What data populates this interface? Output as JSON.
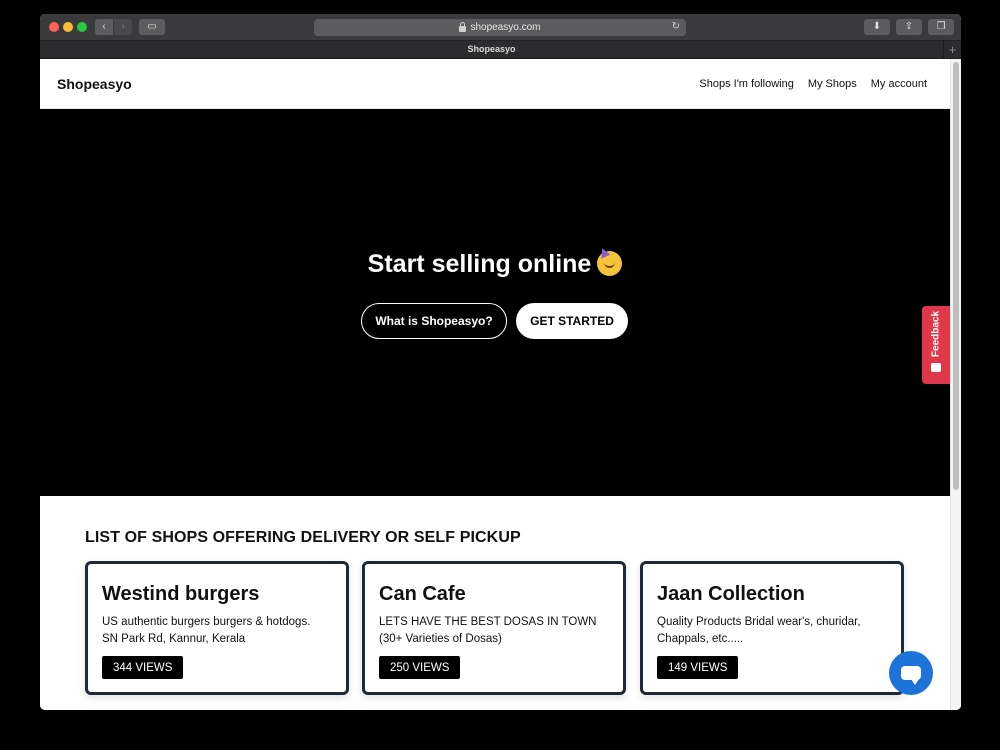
{
  "browser": {
    "url": "shopeasyo.com",
    "tab_title": "Shopeasyo"
  },
  "header": {
    "brand": "Shopeasyo",
    "nav": [
      "Shops I'm following",
      "My Shops",
      "My account"
    ]
  },
  "hero": {
    "title": "Start selling online",
    "emoji_icon": "partying-face-icon",
    "secondary_button": "What is Shopeasyo?",
    "primary_button": "GET STARTED"
  },
  "feedback": {
    "label": "Feedback"
  },
  "shops_section": {
    "title": "LIST OF SHOPS OFFERING DELIVERY OR SELF PICKUP",
    "shops": [
      {
        "name": "Westind burgers",
        "desc_line1": "US authentic burgers burgers & hotdogs.",
        "desc_line2": "SN Park Rd, Kannur, Kerala",
        "views": "344 VIEWS"
      },
      {
        "name": "Can Cafe",
        "desc_line1": "LETS HAVE THE BEST DOSAS IN TOWN",
        "desc_line2": "(30+ Varieties of Dosas)",
        "views": "250 VIEWS"
      },
      {
        "name": "Jaan Collection",
        "desc_line1": "Quality Products Bridal wear's, churidar,",
        "desc_line2": "Chappals, etc.....",
        "views": "149 VIEWS"
      }
    ]
  },
  "colors": {
    "feedback": "#e0374a",
    "chat": "#1e73d8",
    "card_border": "#1f2937"
  }
}
